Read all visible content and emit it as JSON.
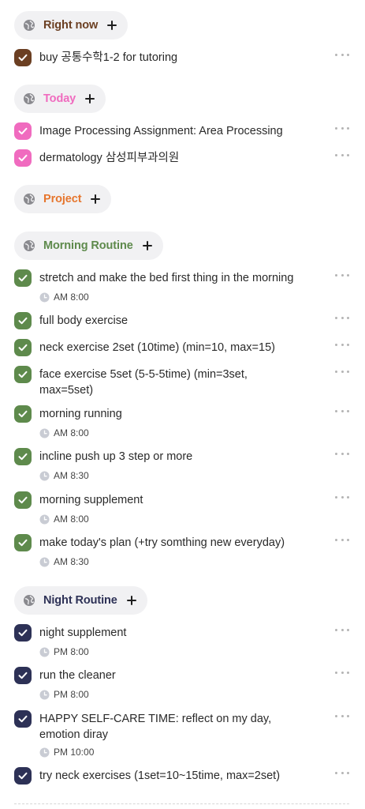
{
  "colors": {
    "right_now": "#6b3f22",
    "today": "#f06bbf",
    "project": "#e6762e",
    "morning": "#5e8a4c",
    "night": "#2d3156"
  },
  "sections": {
    "right_now": {
      "title": "Right now",
      "tasks": [
        {
          "text": "buy 공통수학1-2 for tutoring"
        }
      ]
    },
    "today": {
      "title": "Today",
      "tasks": [
        {
          "text": "Image Processing Assignment: Area Processing"
        },
        {
          "text": "dermatology 삼성피부과의원"
        }
      ]
    },
    "project": {
      "title": "Project",
      "tasks": []
    },
    "morning": {
      "title": "Morning Routine",
      "tasks": [
        {
          "text": "stretch and make the bed first thing in the morning",
          "time": "AM 8:00"
        },
        {
          "text": "full body exercise"
        },
        {
          "text": "neck exercise 2set (10time) (min=10, max=15)"
        },
        {
          "text": "face exercise 5set (5-5-5time) (min=3set, max=5set)"
        },
        {
          "text": "morning running",
          "time": "AM 8:00"
        },
        {
          "text": "incline push up 3 step or more",
          "time": "AM 8:30"
        },
        {
          "text": "morning supplement",
          "time": "AM 8:00"
        },
        {
          "text": "make today's plan (+try somthing new everyday)",
          "time": "AM 8:30"
        }
      ]
    },
    "night": {
      "title": "Night Routine",
      "tasks": [
        {
          "text": "night supplement",
          "time": "PM 8:00"
        },
        {
          "text": "run the cleaner",
          "time": "PM 8:00"
        },
        {
          "text": "HAPPY SELF-CARE TIME: reflect on my day, emotion diray",
          "time": "PM 10:00"
        },
        {
          "text": "try neck exercises (1set=10~15time, max=2set)"
        }
      ]
    }
  }
}
